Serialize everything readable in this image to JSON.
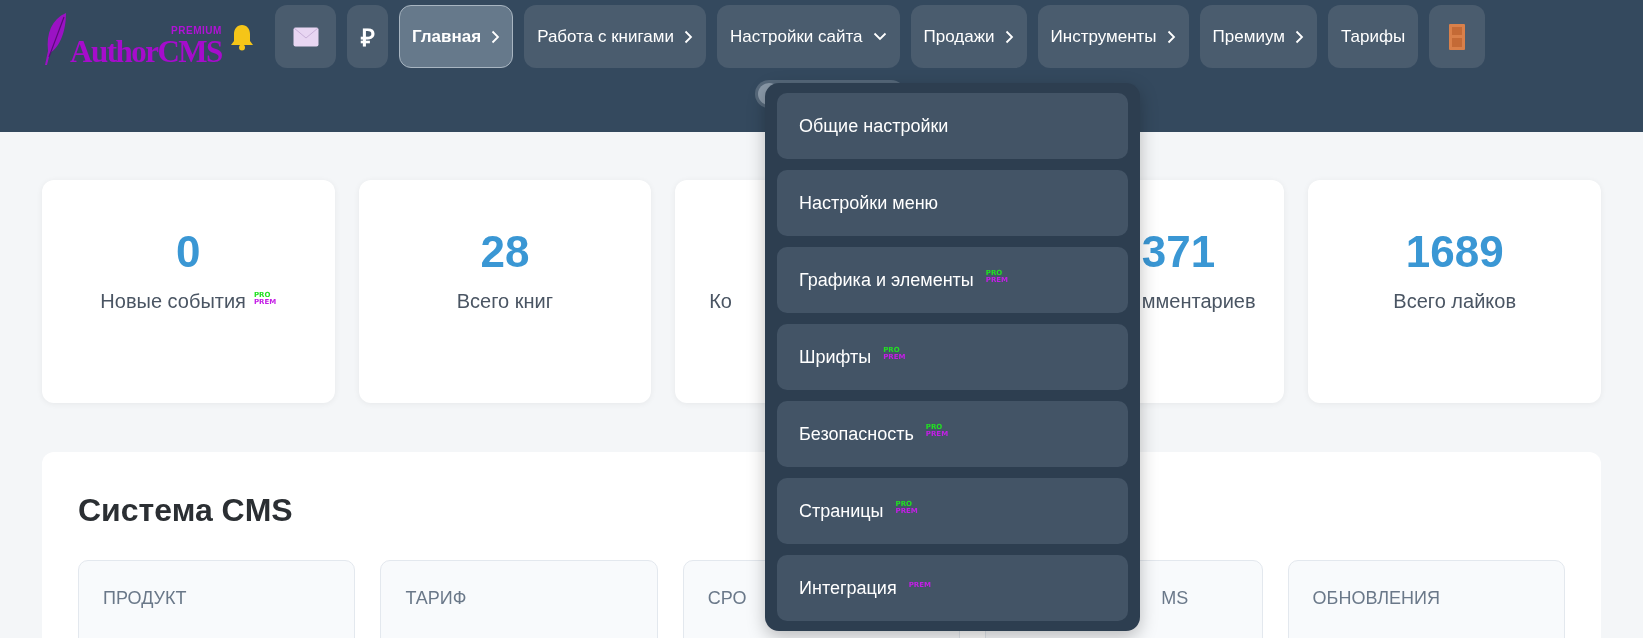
{
  "logo": {
    "badge": "PREMIUM",
    "name": "AuthorCMS"
  },
  "nav": [
    {
      "kind": "bell"
    },
    {
      "kind": "mail",
      "selected": false
    },
    {
      "kind": "text",
      "label": "₽",
      "selected": false
    },
    {
      "kind": "submenu",
      "label": "Главная",
      "selected": true
    },
    {
      "kind": "submenu",
      "label": "Работа с книгами",
      "selected": false
    },
    {
      "kind": "dropdown",
      "label": "Настройки сайта",
      "selected": false
    },
    {
      "kind": "submenu",
      "label": "Продажи",
      "selected": false
    },
    {
      "kind": "submenu",
      "label": "Инструменты",
      "selected": false
    },
    {
      "kind": "submenu",
      "label": "Премиум",
      "selected": false
    },
    {
      "kind": "link",
      "label": "Тарифы",
      "selected": false
    },
    {
      "kind": "door",
      "selected": false
    }
  ],
  "toggle": {
    "on": false
  },
  "dropdown": [
    {
      "label": "Общие настройки"
    },
    {
      "label": "Настройки меню"
    },
    {
      "label": "Графика и элементы",
      "badges": [
        {
          "text": "PRO",
          "color": "#22e022"
        },
        {
          "text": "PREM",
          "color": "#c41ee6"
        }
      ]
    },
    {
      "label": "Шрифты",
      "badges": [
        {
          "text": "PRO",
          "color": "#22e022"
        },
        {
          "text": "PREM",
          "color": "#c41ee6"
        }
      ]
    },
    {
      "label": "Безопасность",
      "badges": [
        {
          "text": "PRO",
          "color": "#22e022"
        },
        {
          "text": "PREM",
          "color": "#c41ee6"
        }
      ]
    },
    {
      "label": "Страницы",
      "badges": [
        {
          "text": "PRO",
          "color": "#22e022"
        },
        {
          "text": "PREM",
          "color": "#c41ee6"
        }
      ]
    },
    {
      "label": "Интеграция",
      "badges": [
        {
          "text": "PREM",
          "color": "#c41ee6"
        }
      ]
    }
  ],
  "stats": [
    {
      "value": "0",
      "label": "Новые события",
      "badges": [
        {
          "text": "PRO",
          "color": "#22e022"
        },
        {
          "text": "PREM",
          "color": "#c41ee6"
        }
      ]
    },
    {
      "value": "28",
      "label": "Всего книг"
    },
    {
      "label": "Ко"
    },
    {
      "value": "371",
      "label": "мментариев"
    },
    {
      "value": "1689",
      "label": "Всего лайков"
    }
  ],
  "system": {
    "title": "Система CMS",
    "cards": [
      {
        "label": "ПРОДУКТ"
      },
      {
        "label": "ТАРИФ"
      },
      {
        "label": "СРО"
      },
      {
        "label": "MS"
      },
      {
        "label": "ОБНОВЛЕНИЯ"
      }
    ]
  }
}
